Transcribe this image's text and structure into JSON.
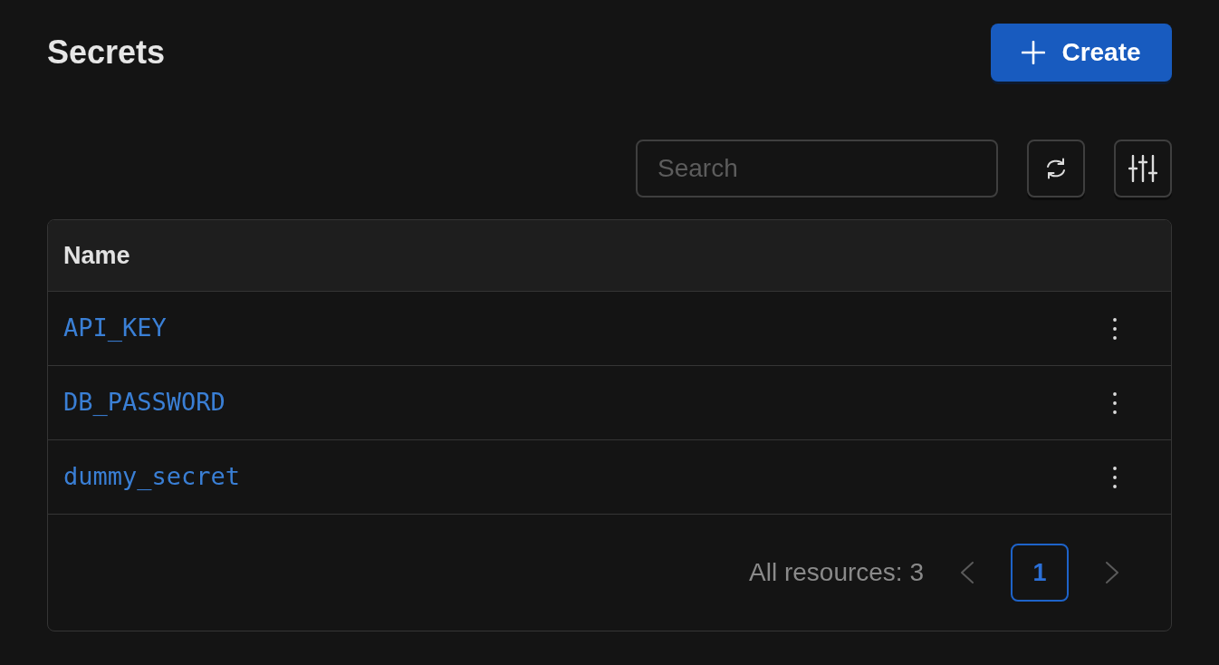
{
  "header": {
    "title": "Secrets",
    "create_button": {
      "label": "Create"
    }
  },
  "toolbar": {
    "search": {
      "placeholder": "Search"
    }
  },
  "table": {
    "columns": [
      {
        "label": "Name"
      }
    ],
    "rows": [
      {
        "name": "API_KEY"
      },
      {
        "name": "DB_PASSWORD"
      },
      {
        "name": "dummy_secret"
      }
    ]
  },
  "footer": {
    "total": "All resources: 3",
    "prev": {
      "disabled": true
    },
    "pages": [
      {
        "label": "1",
        "selected": true
      }
    ],
    "next": {
      "disabled": true
    }
  }
}
